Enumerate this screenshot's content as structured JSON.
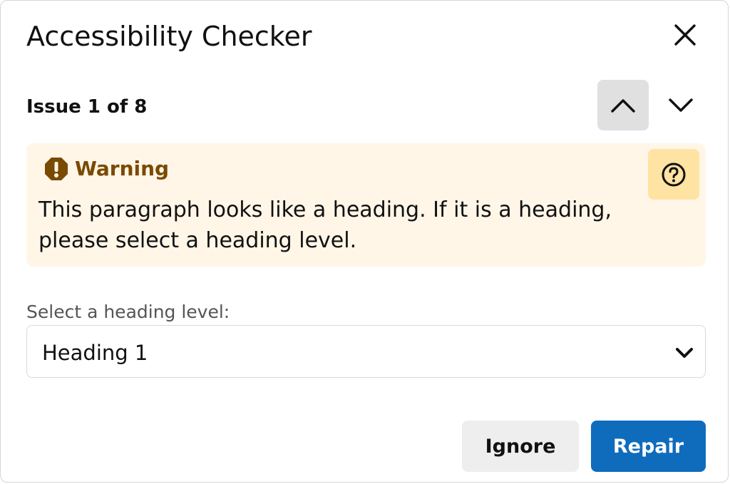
{
  "dialog": {
    "title": "Accessibility Checker",
    "close_icon": "close-icon"
  },
  "issue_nav": {
    "label": "Issue 1 of 8",
    "current": 1,
    "total": 8,
    "prev_icon": "chevron-up-icon",
    "next_icon": "chevron-down-icon"
  },
  "warning": {
    "icon": "warning-octagon-icon",
    "label": "Warning",
    "message": "This paragraph looks like a heading. If it is a heading, please select a heading level.",
    "help_icon": "help-icon",
    "accent_color": "#7a4a00",
    "background_color": "#fff6e8"
  },
  "heading_select": {
    "label": "Select a heading level:",
    "value": "Heading 1",
    "chevron_icon": "chevron-down-icon"
  },
  "actions": {
    "ignore_label": "Ignore",
    "repair_label": "Repair",
    "repair_color": "#0f6cbd"
  }
}
